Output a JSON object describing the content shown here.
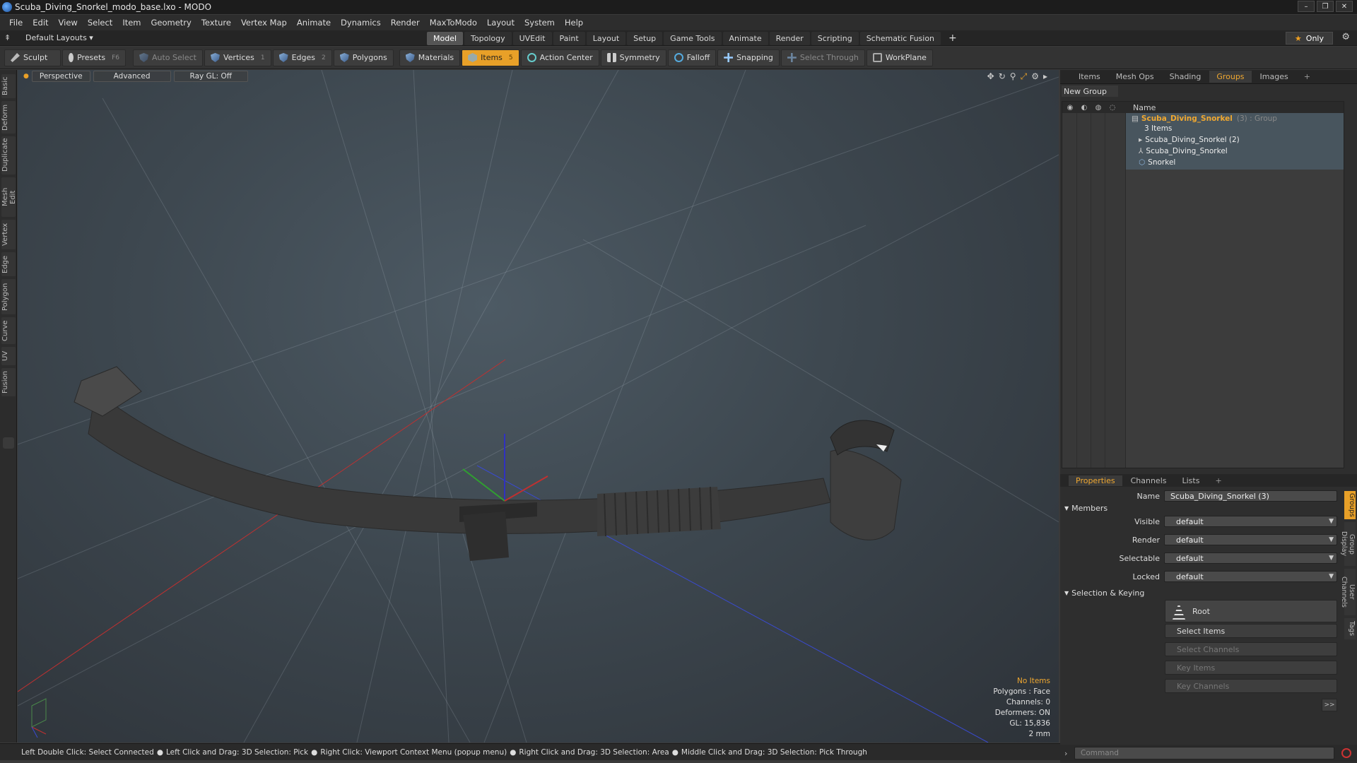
{
  "window": {
    "title": "Scuba_Diving_Snorkel_modo_base.lxo - MODO",
    "buttons": [
      "–",
      "❐",
      "✕"
    ]
  },
  "menu": [
    "File",
    "Edit",
    "View",
    "Select",
    "Item",
    "Geometry",
    "Texture",
    "Vertex Map",
    "Animate",
    "Dynamics",
    "Render",
    "MaxToModo",
    "Layout",
    "System",
    "Help"
  ],
  "layoutbar": {
    "layouts_label": "Default Layouts ▾",
    "tabs": [
      "Model",
      "Topology",
      "UVEdit",
      "Paint",
      "Layout",
      "Setup",
      "Game Tools",
      "Animate",
      "Render",
      "Scripting",
      "Schematic Fusion",
      "+"
    ],
    "active_tab": "Model",
    "only_label": "Only"
  },
  "toolbar": {
    "sculpt": "Sculpt",
    "presets": "Presets",
    "presets_key": "F6",
    "auto_select": "Auto Select",
    "vertices": "Vertices",
    "vertices_key": "1",
    "edges": "Edges",
    "edges_key": "2",
    "polygons": "Polygons",
    "materials": "Materials",
    "items": "Items",
    "items_key": "5",
    "action_center": "Action Center",
    "symmetry": "Symmetry",
    "falloff": "Falloff",
    "snapping": "Snapping",
    "select_through": "Select Through",
    "workplane": "WorkPlane"
  },
  "left_tabs": [
    "Basic",
    "Deform",
    "Duplicate",
    "Mesh Edit",
    "Vertex",
    "Edge",
    "Polygon",
    "Curve",
    "UV",
    "Fusion"
  ],
  "viewport": {
    "perspective": "Perspective",
    "advanced": "Advanced",
    "raygl": "Ray GL: Off",
    "info": {
      "no_items": "No Items",
      "polygons": "Polygons : Face",
      "channels": "Channels: 0",
      "deformers": "Deformers: ON",
      "gl": "GL: 15,836",
      "scale": "2 mm"
    }
  },
  "status": [
    "Left Double Click: Select Connected",
    "Left Click and Drag: 3D Selection: Pick",
    "Right Click: Viewport Context Menu (popup menu)",
    "Right Click and Drag: 3D Selection: Area",
    "Middle Click and Drag: 3D Selection: Pick Through"
  ],
  "outliner": {
    "tabs": [
      "Items",
      "Mesh Ops",
      "Shading",
      "Groups",
      "Images",
      "+"
    ],
    "active_tab": "Groups",
    "new_group": "New Group",
    "name_header": "Name",
    "group_name": "Scuba_Diving_Snorkel",
    "group_suffix": "(3) : Group",
    "group_count": "3 Items",
    "children": [
      "Scuba_Diving_Snorkel (2)",
      "Scuba_Diving_Snorkel",
      "Snorkel"
    ]
  },
  "properties": {
    "tabs": [
      "Properties",
      "Channels",
      "Lists",
      "+"
    ],
    "active_tab": "Properties",
    "name_label": "Name",
    "name_value": "Scuba_Diving_Snorkel (3)",
    "members_label": "Members",
    "visible_label": "Visible",
    "visible_value": "default",
    "render_label": "Render",
    "render_value": "default",
    "selectable_label": "Selectable",
    "selectable_value": "default",
    "locked_label": "Locked",
    "locked_value": "default",
    "selection_keying": "Selection & Keying",
    "root": "Root",
    "select_items": "Select Items",
    "select_channels": "Select Channels",
    "key_items": "Key Items",
    "key_channels": "Key Channels",
    "expander": ">>",
    "side_tabs": [
      "Groups",
      "Group Display",
      "User Channels",
      "Tags"
    ]
  },
  "command": {
    "placeholder": "Command"
  },
  "colors": {
    "accent": "#e8a028",
    "viewport_bg": "#3d474f",
    "panel": "#2e2e2e"
  }
}
